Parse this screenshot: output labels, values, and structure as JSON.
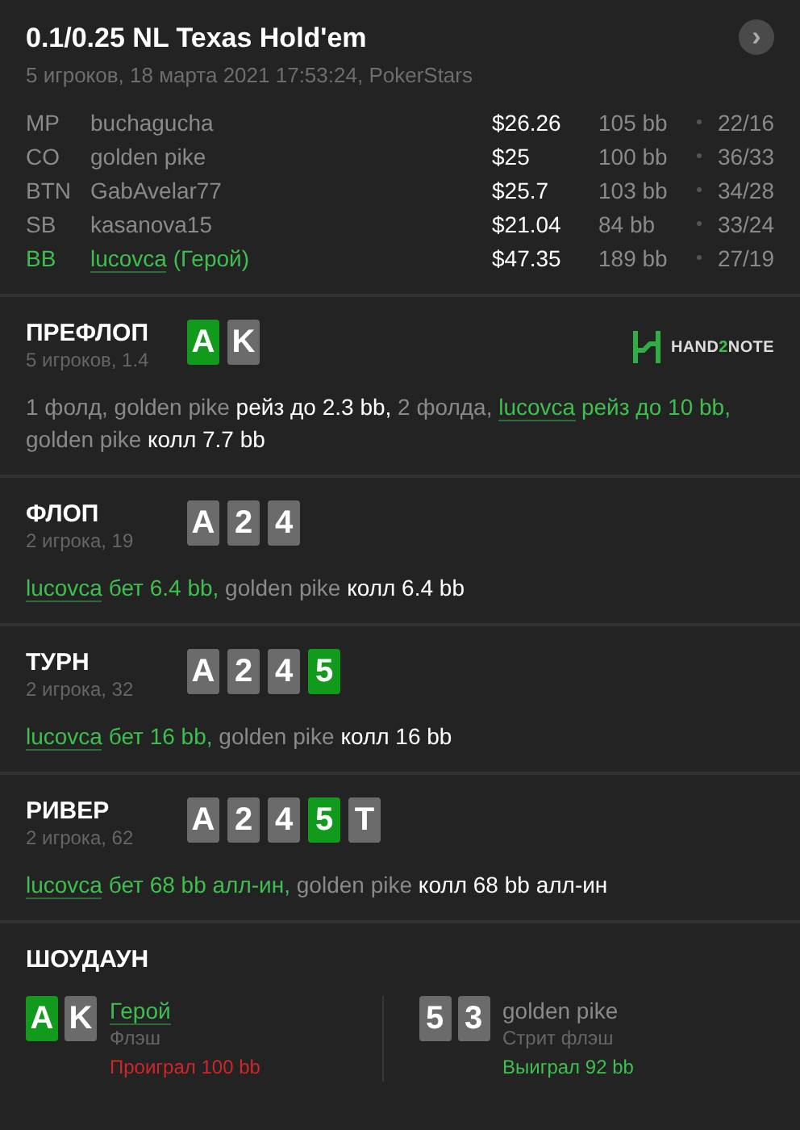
{
  "header": {
    "title": "0.1/0.25 NL Texas Hold'em",
    "subtitle": "5 игроков, 18 марта 2021 17:53:24, PokerStars",
    "next_button": "›"
  },
  "players": [
    {
      "position": "MP",
      "name": "buchagucha",
      "hero": false,
      "stack": "$26.26",
      "bb": "105 bb",
      "stats": "22/16"
    },
    {
      "position": "CO",
      "name": "golden pike",
      "hero": false,
      "stack": "$25",
      "bb": "100 bb",
      "stats": "36/33"
    },
    {
      "position": "BTN",
      "name": "GabAvelar77",
      "hero": false,
      "stack": "$25.7",
      "bb": "103 bb",
      "stats": "34/28"
    },
    {
      "position": "SB",
      "name": "kasanova15",
      "hero": false,
      "stack": "$21.04",
      "bb": "84 bb",
      "stats": "33/24"
    },
    {
      "position": "BB",
      "name": "lucovca",
      "suffix": " (Герой)",
      "hero": true,
      "stack": "$47.35",
      "bb": "189 bb",
      "stats": "27/19"
    }
  ],
  "streets": [
    {
      "name": "ПРЕФЛОП",
      "info": "5 игроков, 1.4",
      "logo": [
        "HAND",
        "2",
        "NOTE"
      ],
      "cards": [
        {
          "rank": "A",
          "color": "#119a1c"
        },
        {
          "rank": "K",
          "color": "#6b6b6b"
        }
      ],
      "actions": [
        {
          "kind": "note",
          "text": "1 фолд, golden pike "
        },
        {
          "kind": "bet",
          "text": "рейз до 2.3 bb,"
        },
        {
          "kind": "note",
          "text": " 2 фолда, "
        },
        {
          "kind": "hero",
          "text": "lucovca"
        },
        {
          "kind": "hero-bet",
          "text": " рейз до 10 bb,"
        },
        {
          "kind": "note",
          "text": " golden pike "
        },
        {
          "kind": "bet",
          "text": "колл 7.7 bb"
        }
      ]
    },
    {
      "name": "ФЛОП",
      "info": "2 игрока, 19",
      "cards": [
        {
          "rank": "A",
          "color": "#6b6b6b"
        },
        {
          "rank": "2",
          "color": "#6b6b6b"
        },
        {
          "rank": "4",
          "color": "#6b6b6b"
        }
      ],
      "actions": [
        {
          "kind": "hero",
          "text": "lucovca"
        },
        {
          "kind": "hero-bet",
          "text": " бет 6.4 bb,"
        },
        {
          "kind": "note",
          "text": " golden pike "
        },
        {
          "kind": "bet",
          "text": "колл 6.4 bb"
        }
      ]
    },
    {
      "name": "ТУРН",
      "info": "2 игрока, 32",
      "cards": [
        {
          "rank": "A",
          "color": "#6b6b6b"
        },
        {
          "rank": "2",
          "color": "#6b6b6b"
        },
        {
          "rank": "4",
          "color": "#6b6b6b"
        },
        {
          "rank": "5",
          "color": "#119a1c"
        }
      ],
      "actions": [
        {
          "kind": "hero",
          "text": "lucovca"
        },
        {
          "kind": "hero-bet",
          "text": " бет 16 bb,"
        },
        {
          "kind": "note",
          "text": " golden pike "
        },
        {
          "kind": "bet",
          "text": "колл 16 bb"
        }
      ]
    },
    {
      "name": "РИВЕР",
      "info": "2 игрока, 62",
      "cards": [
        {
          "rank": "A",
          "color": "#6b6b6b"
        },
        {
          "rank": "2",
          "color": "#6b6b6b"
        },
        {
          "rank": "4",
          "color": "#6b6b6b"
        },
        {
          "rank": "5",
          "color": "#119a1c"
        },
        {
          "rank": "T",
          "color": "#6b6b6b"
        }
      ],
      "actions": [
        {
          "kind": "hero",
          "text": "lucovca"
        },
        {
          "kind": "hero-bet",
          "text": " бет 68 bb алл-ин,"
        },
        {
          "kind": "note",
          "text": " golden pike "
        },
        {
          "kind": "bet",
          "text": "колл 68 bb алл-ин"
        }
      ]
    }
  ],
  "showdown": {
    "title": "ШОУДАУН",
    "hands": [
      {
        "name": "Герой",
        "hero": true,
        "hand": "Флэш",
        "result": "Проиграл 100 bb",
        "won": false,
        "cards": [
          {
            "rank": "A",
            "color": "#119a1c"
          },
          {
            "rank": "K",
            "color": "#6b6b6b"
          }
        ]
      },
      {
        "name": "golden pike",
        "hero": false,
        "hand": "Стрит флэш",
        "result": "Выиграл 92 bb",
        "won": true,
        "cards": [
          {
            "rank": "5",
            "color": "#6b6b6b"
          },
          {
            "rank": "3",
            "color": "#6b6b6b"
          }
        ]
      }
    ]
  }
}
